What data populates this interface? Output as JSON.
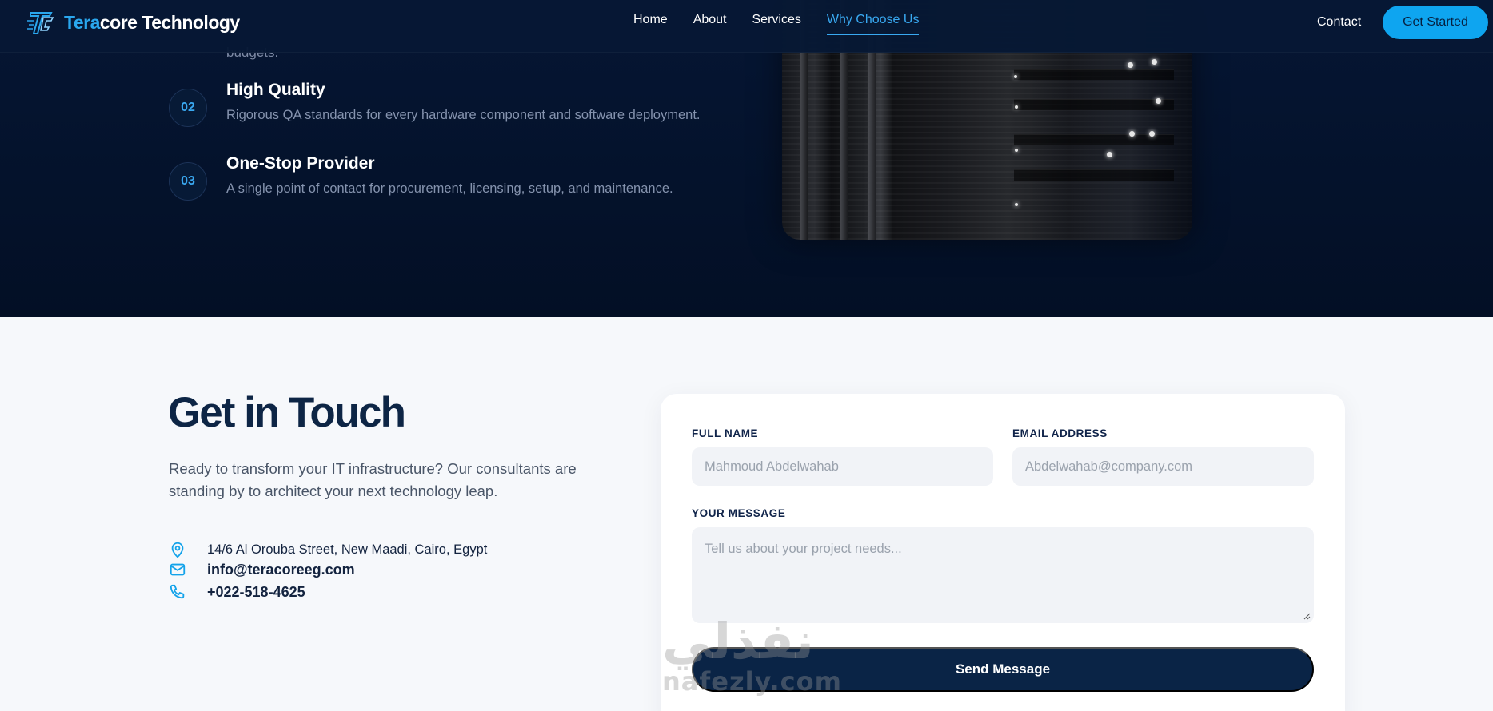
{
  "nav": {
    "brand_prefix": "Tera",
    "brand_suffix": "core Technology",
    "links": [
      "Home",
      "About",
      "Services",
      "Why Choose Us"
    ],
    "active": "Why Choose Us",
    "contact": "Contact",
    "cta": "Get Started"
  },
  "why": {
    "cut_text": "budgets.",
    "features": [
      {
        "num": "02",
        "title": "High Quality",
        "desc": "Rigorous QA standards for every hardware component and software deployment."
      },
      {
        "num": "03",
        "title": "One-Stop Provider",
        "desc": "A single point of contact for procurement, licensing, setup, and maintenance."
      }
    ]
  },
  "contact": {
    "heading": "Get in Touch",
    "lead": "Ready to transform your IT infrastructure? Our consultants are standing by to architect your next technology leap.",
    "address": "14/6 Al Orouba Street, New Maadi, Cairo, Egypt",
    "email": "info@teracoreeg.com",
    "phone": "+022-518-4625"
  },
  "form": {
    "name_label": "FULL NAME",
    "name_placeholder": "Mahmoud Abdelwahab",
    "email_label": "EMAIL ADDRESS",
    "email_placeholder": "Abdelwahab@company.com",
    "message_label": "YOUR MESSAGE",
    "message_placeholder": "Tell us about your project needs...",
    "submit": "Send Message"
  },
  "watermark": {
    "arabic": "نفذلي",
    "latin": "nafezly.com"
  },
  "colors": {
    "accent": "#0ea5f0",
    "navy": "#0a2446",
    "dark_bg": "#04122b"
  }
}
